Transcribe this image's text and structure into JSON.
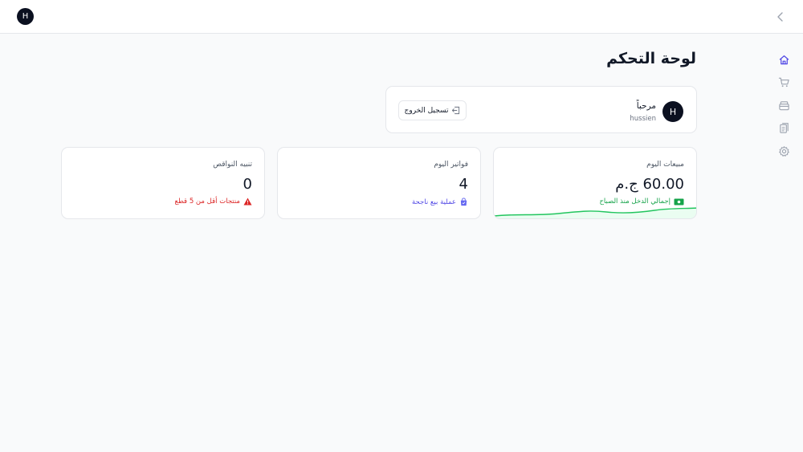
{
  "topbar": {
    "avatar_initial": "H"
  },
  "sidebar": {
    "items": [
      {
        "name": "home",
        "icon": "home-icon",
        "active": true
      },
      {
        "name": "cart",
        "icon": "cart-icon",
        "active": false
      },
      {
        "name": "inventory",
        "icon": "box-icon",
        "active": false
      },
      {
        "name": "reports",
        "icon": "clipboard-icon",
        "active": false
      },
      {
        "name": "settings",
        "icon": "gear-icon",
        "active": false
      }
    ]
  },
  "page": {
    "title": "لوحة التحكم"
  },
  "welcome": {
    "avatar_initial": "H",
    "greeting": "مرحباً",
    "username": "hussien",
    "logout_label": "تسجيل الخروج"
  },
  "stats": {
    "sales": {
      "label": "مبيعات اليوم",
      "value": "60.00 ج.م",
      "note": "إجمالي الدخل منذ الصباح",
      "note_color": "#16a34a"
    },
    "invoices": {
      "label": "فواتير اليوم",
      "value": "4",
      "note": "عملية بيع ناجحة",
      "note_color": "#4f46e5"
    },
    "alerts": {
      "label": "تنبيه النواقص",
      "value": "0",
      "note": "منتجات أقل من 5 قطع",
      "note_color": "#dc2626"
    }
  },
  "colors": {
    "accent": "#4f46e5",
    "success": "#16a34a",
    "danger": "#dc2626",
    "dark": "#0b1020"
  }
}
